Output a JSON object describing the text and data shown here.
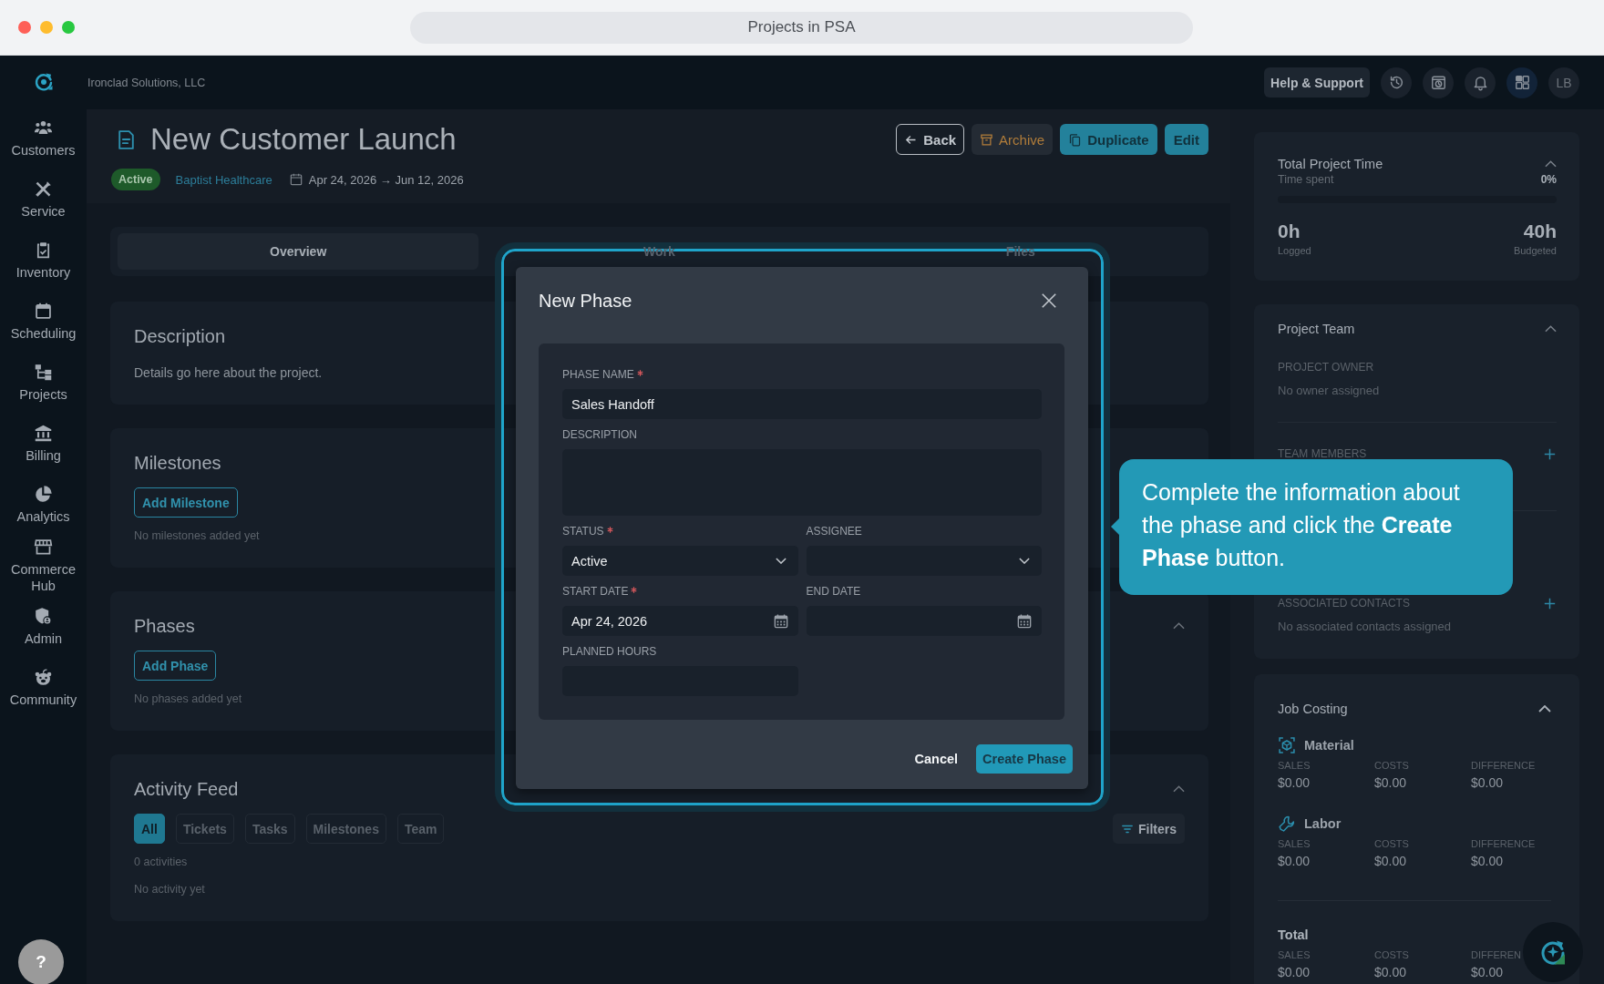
{
  "browser": {
    "title": "Projects in PSA"
  },
  "sidebar": {
    "items": [
      {
        "label": "Customers",
        "selected": false
      },
      {
        "label": "Service",
        "selected": false
      },
      {
        "label": "Inventory",
        "selected": false
      },
      {
        "label": "Scheduling",
        "selected": false
      },
      {
        "label": "Projects",
        "selected": false
      },
      {
        "label": "Billing",
        "selected": false
      },
      {
        "label": "Analytics",
        "selected": false
      },
      {
        "label": "Commerce Hub",
        "selected": false
      },
      {
        "label": "Admin",
        "selected": false
      },
      {
        "label": "Community",
        "selected": false
      }
    ],
    "help_button": "?"
  },
  "top_bar": {
    "company": "Ironclad Solutions, LLC",
    "help_button": "Help & Support",
    "tools": [
      {
        "selected": false
      },
      {
        "selected": false
      },
      {
        "selected": false
      },
      {
        "selected": true
      }
    ],
    "avatar": "LB"
  },
  "project": {
    "title": "New Customer Launch",
    "status": "Active",
    "customer": "Baptist Healthcare",
    "dates": "Apr 24, 2026 → Jun 12, 2026",
    "actions": [
      {
        "label": "Back",
        "kind": "back"
      },
      {
        "label": "Archive",
        "kind": "archive"
      },
      {
        "label": "Duplicate",
        "kind": "duplicate"
      },
      {
        "label": "Edit",
        "kind": "edit"
      }
    ]
  },
  "tabs": [
    {
      "label": "Overview",
      "selected": true
    },
    {
      "label": "Work",
      "selected": false
    },
    {
      "label": "Files",
      "selected": false
    }
  ],
  "description": {
    "title": "Description",
    "text": "Details go here about the project."
  },
  "milestones": {
    "title": "Milestones",
    "button": "Add Milestone",
    "empty": "No milestones added yet"
  },
  "phases": {
    "title": "Phases",
    "expanded": true,
    "button": "Add Phase",
    "empty": "No phases added yet"
  },
  "activity_feed": {
    "title": "Activity Feed",
    "expanded": true,
    "filters": [
      {
        "label": "All",
        "selected": true
      },
      {
        "label": "Tickets",
        "selected": false
      },
      {
        "label": "Tasks",
        "selected": false
      },
      {
        "label": "Milestones",
        "selected": false
      },
      {
        "label": "Team",
        "selected": false
      }
    ],
    "filters_button": "Filters",
    "count": "0 activities",
    "empty": "No activity yet"
  },
  "time_card": {
    "title": "Total Project Time",
    "expanded": true,
    "subtitle": "Time spent",
    "percent": "0%",
    "level": 0,
    "logged": "0h",
    "logged_label": "Logged",
    "budgeted": "40h",
    "budgeted_label": "Budgeted"
  },
  "team_card": {
    "title": "Project Team",
    "expanded": true,
    "sections": [
      {
        "label": "PROJECT OWNER",
        "text": "No owner assigned",
        "addable": false
      },
      {
        "label": "TEAM MEMBERS",
        "addable": true
      },
      {
        "label": "ASSOCIATED CONTACTS",
        "text": "No associated contacts assigned",
        "addable": true
      }
    ]
  },
  "job_costing": {
    "title": "Job Costing",
    "expanded": true,
    "groups": [
      {
        "name": "Material",
        "kind": "material",
        "cells": [
          {
            "label": "SALES",
            "value": "$0.00"
          },
          {
            "label": "COSTS",
            "value": "$0.00"
          },
          {
            "label": "DIFFERENCE",
            "value": "$0.00"
          }
        ]
      },
      {
        "name": "Labor",
        "kind": "labor",
        "cells": [
          {
            "label": "SALES",
            "value": "$0.00"
          },
          {
            "label": "COSTS",
            "value": "$0.00"
          },
          {
            "label": "DIFFERENCE",
            "value": "$0.00"
          }
        ]
      },
      {
        "name": "Total",
        "kind": "total",
        "cells": [
          {
            "label": "SALES",
            "value": "$0.00"
          },
          {
            "label": "COSTS",
            "value": "$0.00"
          },
          {
            "label": "DIFFEREN",
            "value": "$0.00"
          }
        ]
      }
    ]
  },
  "modal": {
    "title": "New Phase",
    "fields": [
      {
        "label": "PHASE NAME",
        "required": true,
        "kind": "text",
        "value": "Sales Handoff"
      },
      {
        "label": "DESCRIPTION",
        "required": false,
        "kind": "textarea"
      },
      {
        "label": "STATUS",
        "required": true,
        "kind": "select",
        "value": "Active"
      },
      {
        "label": "ASSIGNEE",
        "required": false,
        "kind": "select"
      },
      {
        "label": "START DATE",
        "required": true,
        "kind": "date",
        "value": "Apr 24, 2026"
      },
      {
        "label": "END DATE",
        "required": false,
        "kind": "date"
      },
      {
        "label": "PLANNED HOURS",
        "required": false,
        "kind": "number"
      }
    ],
    "buttons": [
      {
        "label": "Cancel",
        "kind": "secondary"
      },
      {
        "label": "Create Phase",
        "kind": "primary"
      }
    ]
  },
  "tooltip": {
    "text": "Complete the information about the phase and click the **Create Phase** button."
  }
}
